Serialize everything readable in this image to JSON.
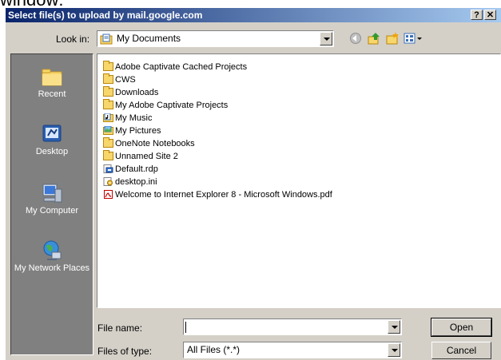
{
  "caption": "window:",
  "titlebar": {
    "title": "Select file(s) to upload by mail.google.com",
    "help_label": "?",
    "close_label": "✕"
  },
  "lookin": {
    "label": "Look in:",
    "value": "My Documents"
  },
  "toolbar": {
    "back_icon": "back-icon",
    "up_icon": "up-folder-icon",
    "new_folder_icon": "new-folder-icon",
    "views_icon": "views-menu-icon"
  },
  "places": [
    {
      "label": "Recent",
      "icon": "recent-icon"
    },
    {
      "label": "Desktop",
      "icon": "desktop-icon"
    },
    {
      "label": "My Computer",
      "icon": "my-computer-icon"
    },
    {
      "label": "My Network Places",
      "icon": "network-places-icon"
    }
  ],
  "files": [
    {
      "name": "Adobe Captivate Cached Projects",
      "type": "folder"
    },
    {
      "name": "CWS",
      "type": "folder"
    },
    {
      "name": "Downloads",
      "type": "folder"
    },
    {
      "name": "My Adobe Captivate Projects",
      "type": "folder"
    },
    {
      "name": "My Music",
      "type": "music-folder"
    },
    {
      "name": "My Pictures",
      "type": "pictures-folder"
    },
    {
      "name": "OneNote Notebooks",
      "type": "folder"
    },
    {
      "name": "Unnamed Site 2",
      "type": "folder"
    },
    {
      "name": "Default.rdp",
      "type": "rdp-file"
    },
    {
      "name": "desktop.ini",
      "type": "ini-file"
    },
    {
      "name": "Welcome to Internet Explorer 8 - Microsoft Windows.pdf",
      "type": "pdf-file"
    }
  ],
  "filename": {
    "label": "File name:",
    "value": ""
  },
  "filetype": {
    "label": "Files of type:",
    "value": "All Files (*.*)"
  },
  "buttons": {
    "open": "Open",
    "cancel": "Cancel"
  },
  "colors": {
    "title_start": "#0a246a",
    "title_end": "#a6caf0",
    "face": "#d4d0c8",
    "places_bg": "#808080"
  }
}
